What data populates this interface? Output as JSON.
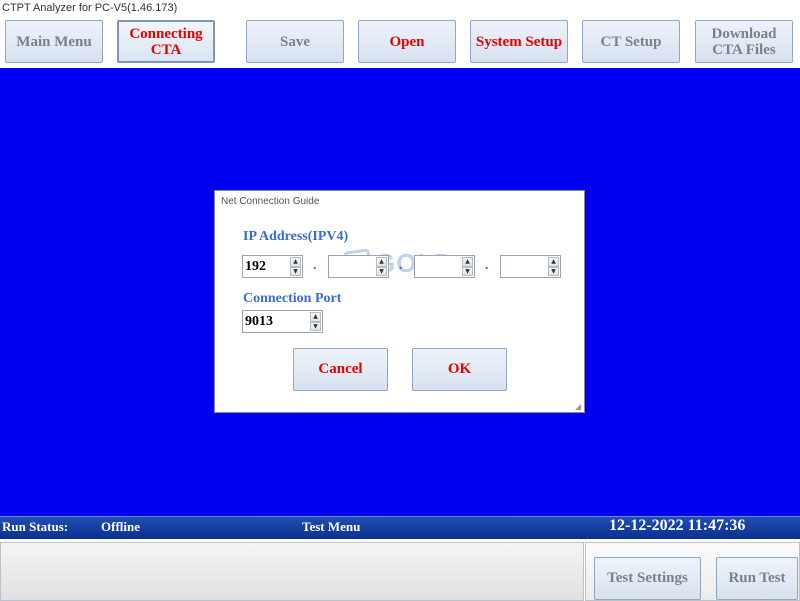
{
  "window": {
    "title": "CTPT Analyzer for PC-V5(1.46.173)"
  },
  "toolbar": {
    "main_menu": "Main Menu",
    "connecting_cta": "Connecting CTA",
    "save": "Save",
    "open": "Open",
    "system_setup": "System Setup",
    "ct_setup": "CT Setup",
    "download_cta_files": "Download CTA Files"
  },
  "dialog": {
    "title": "Net Connection Guide",
    "ip_label": "IP Address(IPV4)",
    "ip_octets": [
      "192",
      "",
      "",
      ""
    ],
    "separator": ".",
    "port_label": "Connection Port",
    "port_value": "9013",
    "cancel_label": "Cancel",
    "ok_label": "OK",
    "watermark_text": "GOLD"
  },
  "status": {
    "run_status_label": "Run Status:",
    "run_status_value": "Offline",
    "menu": "Test Menu",
    "datetime": "12-12-2022 11:47:36"
  },
  "bottom": {
    "test_settings": "Test Settings",
    "run_test": "Run Test"
  },
  "colors": {
    "main_background": "#0000f5",
    "button_text_red": "#e60000",
    "button_text_gray": "#7a8288",
    "label_blue": "#3a6cd6",
    "status_bar": "#1f4fb5"
  },
  "icons": {
    "spinner_up": "▲",
    "spinner_down": "▼",
    "resize_grip": "◢"
  }
}
